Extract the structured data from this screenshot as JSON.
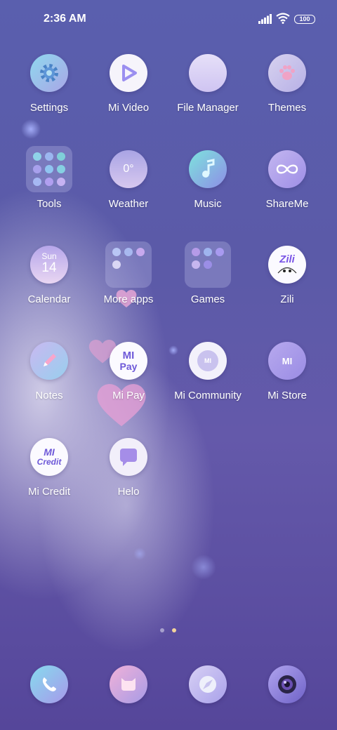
{
  "status_bar": {
    "time": "2:36 AM",
    "battery": "100"
  },
  "apps": [
    {
      "label": "Settings"
    },
    {
      "label": "Mi Video"
    },
    {
      "label": "File Manager"
    },
    {
      "label": "Themes"
    },
    {
      "label": "Tools"
    },
    {
      "label": "Weather",
      "icon_text": "0°"
    },
    {
      "label": "Music"
    },
    {
      "label": "ShareMe"
    },
    {
      "label": "Calendar",
      "icon_day": "Sun",
      "icon_date": "14"
    },
    {
      "label": "More apps"
    },
    {
      "label": "Games"
    },
    {
      "label": "Zili",
      "icon_text": "Zili"
    },
    {
      "label": "Notes"
    },
    {
      "label": "Mi Pay",
      "icon_text_1": "MI",
      "icon_text_2": "Pay"
    },
    {
      "label": "Mi Community",
      "icon_text": "MI"
    },
    {
      "label": "Mi Store",
      "icon_text": "MI"
    },
    {
      "label": "Mi Credit",
      "icon_text_1": "MI",
      "icon_text_2": "Credit"
    },
    {
      "label": "Helo"
    }
  ],
  "page_indicator": {
    "total": 2,
    "active": 2
  },
  "dock": [
    "phone-icon",
    "messages-icon",
    "browser-icon",
    "camera-icon"
  ]
}
